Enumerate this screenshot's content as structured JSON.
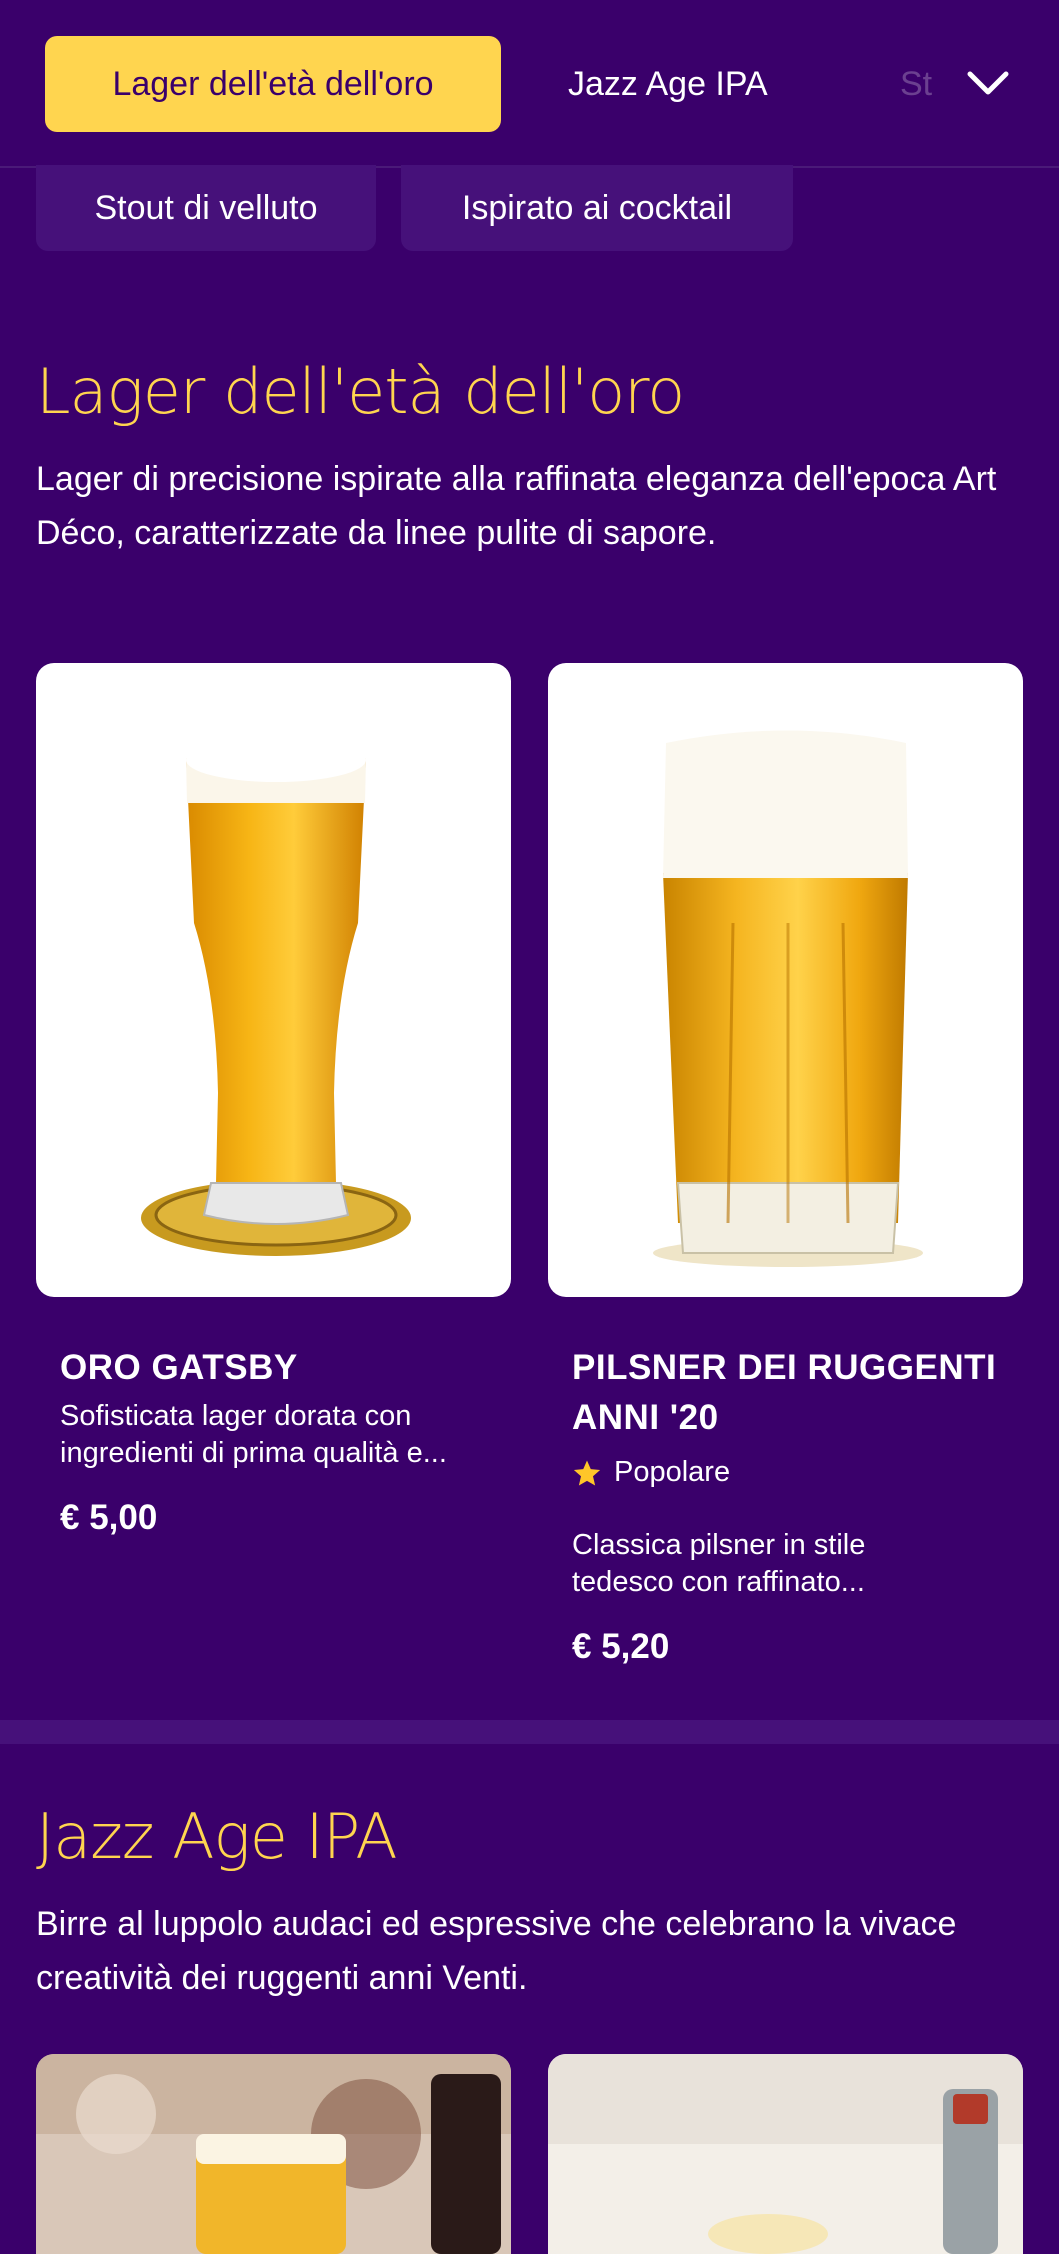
{
  "nav": {
    "tabs": [
      {
        "label": "Lager dell'età dell'oro",
        "active": true
      },
      {
        "label": "Jazz Age IPA",
        "active": false
      },
      {
        "label": "St",
        "active": false
      }
    ],
    "chips": [
      "Stout di velluto",
      "Ispirato ai cocktail"
    ],
    "expand_icon": "chevron-down-icon"
  },
  "sections": [
    {
      "title": "Lager dell'età dell'oro",
      "description": "Lager di precisione ispirate alla raffinata eleganza dell'epoca Art Déco, caratterizzate da linee pulite di sapore.",
      "items": [
        {
          "name": "ORO GATSBY",
          "badge": null,
          "description": "Sofisticata lager dorata con ingredienti di prima qualità e...",
          "price": "€ 5,00"
        },
        {
          "name": "PILSNER DEI RUGGENTI ANNI '20",
          "badge": "Popolare",
          "description": "Classica pilsner in stile tedesco con raffinato...",
          "price": "€ 5,20"
        }
      ]
    },
    {
      "title": "Jazz Age IPA",
      "description": "Birre al luppolo audaci ed espressive che celebrano la vivace creatività dei ruggenti anni Venti."
    }
  ],
  "colors": {
    "background": "#3a006b",
    "accent": "#ffd54f",
    "chip": "#46117a"
  }
}
